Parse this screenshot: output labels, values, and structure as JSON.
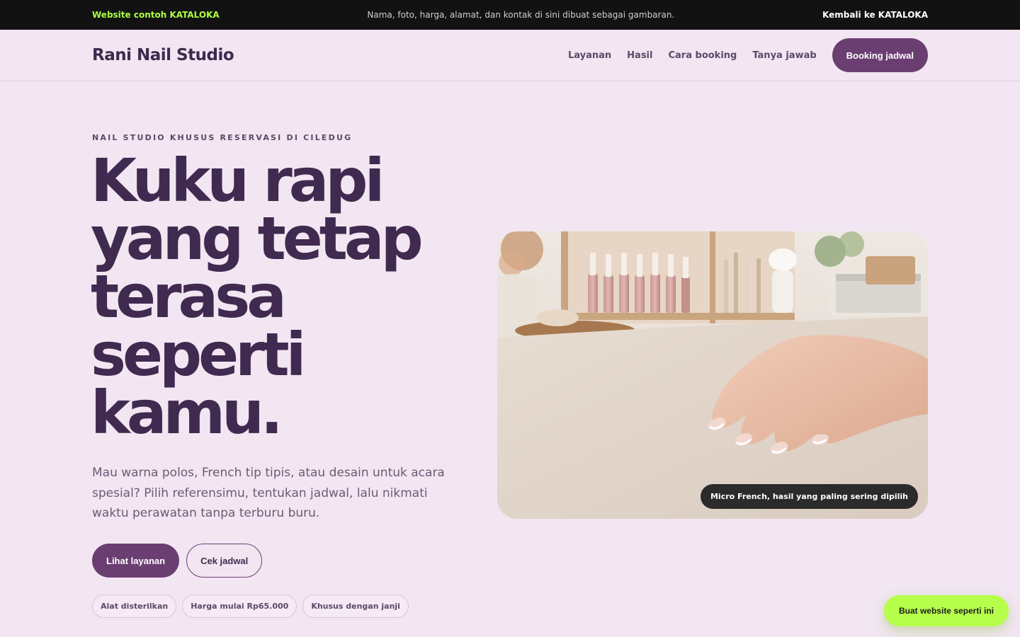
{
  "topbar": {
    "brand": "Website contoh KATALOKA",
    "note": "Nama, foto, harga, alamat, dan kontak di sini dibuat sebagai gambaran.",
    "back_link": "Kembali ke KATALOKA"
  },
  "navbar": {
    "logo": "Rani Nail Studio",
    "links": [
      "Layanan",
      "Hasil",
      "Cara booking",
      "Tanya jawab"
    ],
    "booking_button": "Booking jadwal"
  },
  "hero": {
    "eyebrow": "NAIL STUDIO KHUSUS RESERVASI DI CILEDUG",
    "headline": "Kuku rapi yang tetap terasa seperti kamu.",
    "subtext": "Mau warna polos, French tip tipis, atau desain untuk acara spesial? Pilih referensimu, tentukan jadwal, lalu nikmati waktu perawatan tanpa terburu buru.",
    "primary_cta": "Lihat layanan",
    "secondary_cta": "Cek jadwal",
    "chips": [
      "Alat disterilkan",
      "Harga mulai Rp65.000",
      "Khusus dengan janji"
    ],
    "photo_caption": "Micro French, hasil yang paling sering dipilih"
  },
  "floating_cta": "Buat website seperti ini",
  "colors": {
    "page_background": "#f2e6f2",
    "primary": "#6b3e72",
    "headline": "#402a4f",
    "topbar_background": "#121212",
    "topbar_brand": "#a9ff43",
    "floating_cta": "#b6ff4a"
  }
}
